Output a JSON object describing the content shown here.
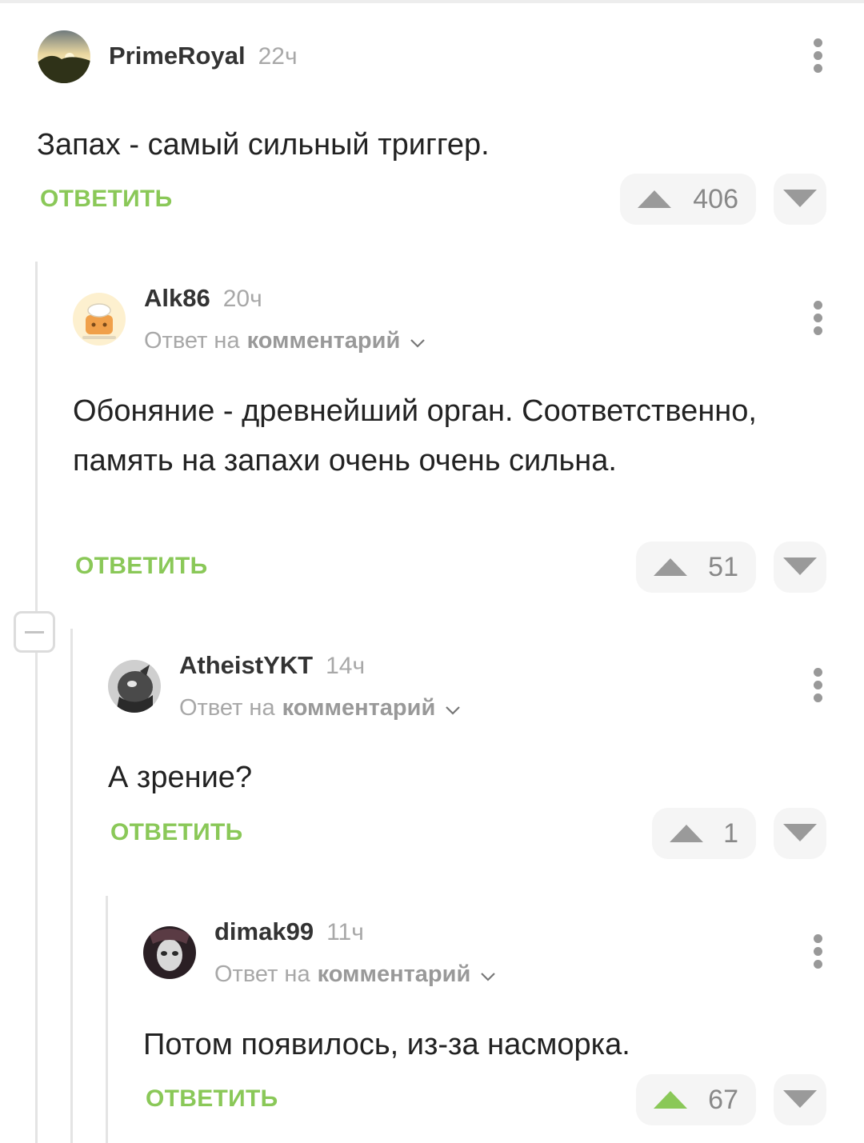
{
  "comments": [
    {
      "username": "PrimeRoyal",
      "time": "22ч",
      "text": "Запах - самый сильный триггер.",
      "reply_label": "ОТВЕТИТЬ",
      "score": "406",
      "upvoted": false
    },
    {
      "username": "Alk86",
      "time": "20ч",
      "reply_to_prefix": "Ответ на",
      "reply_to_link": "комментарий",
      "text": "Обоняние - древнейший орган. Соответственно, память на запахи очень очень сильна.",
      "reply_label": "ОТВЕТИТЬ",
      "score": "51",
      "upvoted": false
    },
    {
      "username": "AtheistYKT",
      "time": "14ч",
      "reply_to_prefix": "Ответ на",
      "reply_to_link": "комментарий",
      "text": "А зрение?",
      "reply_label": "ОТВЕТИТЬ",
      "score": "1",
      "upvoted": false
    },
    {
      "username": "dimak99",
      "time": "11ч",
      "reply_to_prefix": "Ответ на",
      "reply_to_link": "комментарий",
      "text": "Потом появилось, из-за насморка.",
      "reply_label": "ОТВЕТИТЬ",
      "score": "67",
      "upvoted": true
    }
  ],
  "colors": {
    "accent_green": "#8ac858",
    "vote_inactive": "#9a9a9a",
    "text_primary": "#222222",
    "text_muted": "#a8a8a8"
  },
  "icons": {
    "more": "more-vertical-icon",
    "upvote": "upvote-arrow-icon",
    "downvote": "downvote-arrow-icon",
    "chevron": "chevron-down-icon",
    "collapse": "minus-icon"
  }
}
